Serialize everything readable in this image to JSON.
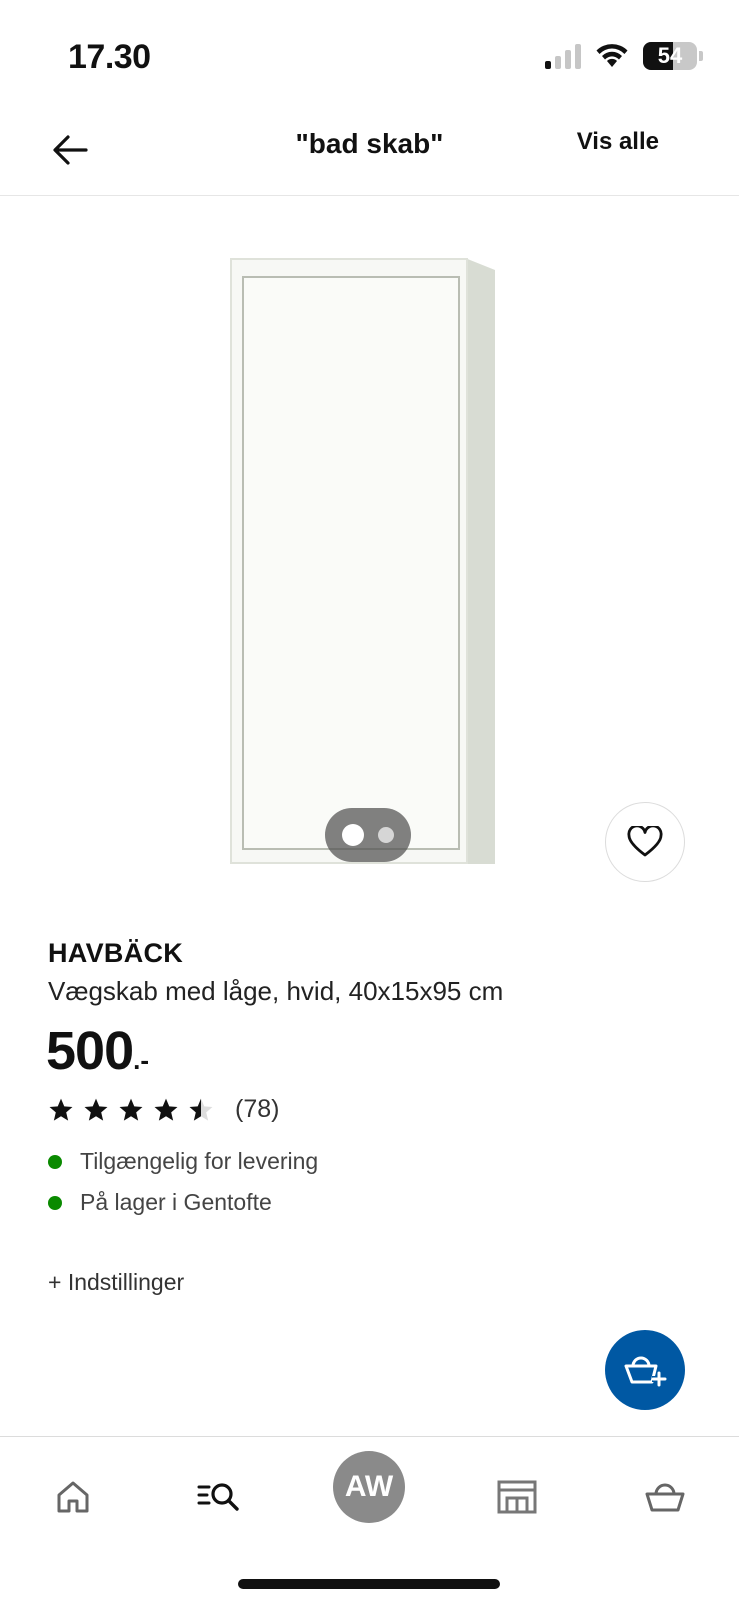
{
  "status_bar": {
    "time": "17.30",
    "battery": "54"
  },
  "header": {
    "title": "\"bad skab\"",
    "view_all": "Vis alle"
  },
  "product": {
    "brand": "HAVBÄCK",
    "description": "Vægskab med låge, hvid, 40x15x95 cm",
    "price": "500",
    "price_suffix": ".-",
    "rating": 4.5,
    "rating_count": "(78)",
    "availability": [
      "Tilgængelig for levering",
      "På lager i Gentofte"
    ],
    "options_link": "+ Indstillinger"
  },
  "carousel": {
    "count": 2,
    "active": 1
  },
  "colors": {
    "accent": "#0058a3",
    "in_stock": "#0a8a00",
    "avatar_bg": "#8a8a8a"
  },
  "bottom_nav": {
    "avatar_initials": "AW",
    "items": [
      "home-icon",
      "search-list-icon",
      "avatar",
      "store-icon",
      "basket-icon"
    ]
  }
}
